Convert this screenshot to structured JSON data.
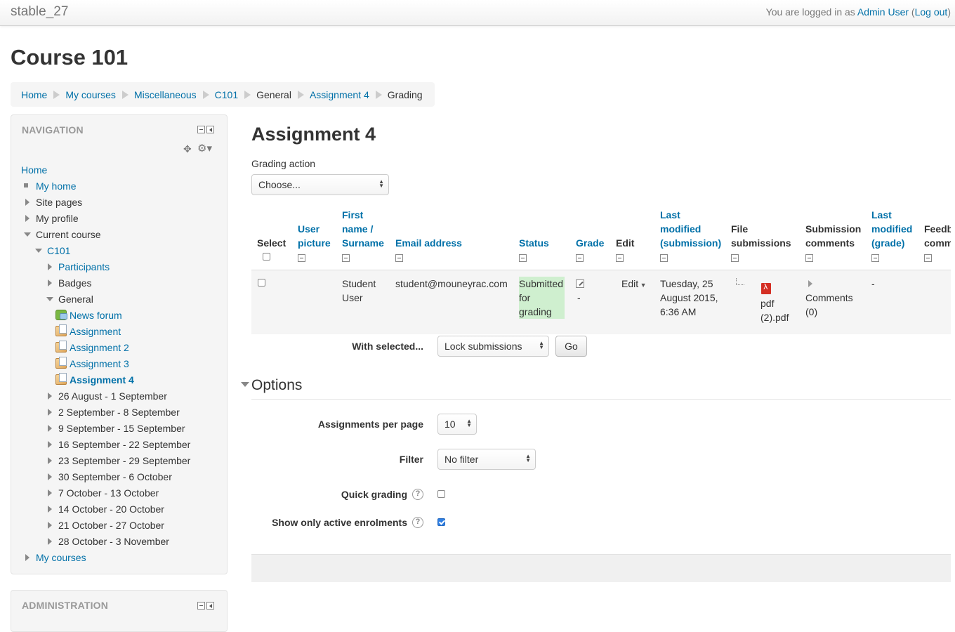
{
  "header": {
    "site_name": "stable_27",
    "logged_in_prefix": "You are logged in as ",
    "user_name": "Admin User",
    "logout_open": " (",
    "logout_label": "Log out",
    "logout_close": ")"
  },
  "course_title": "Course 101",
  "breadcrumb": [
    "Home",
    "My courses",
    "Miscellaneous",
    "C101",
    "General",
    "Assignment 4",
    "Grading"
  ],
  "navigation": {
    "title": "NAVIGATION",
    "items": [
      {
        "label": "Home"
      },
      {
        "label": "My home"
      },
      {
        "label": "Site pages"
      },
      {
        "label": "My profile"
      },
      {
        "label": "Current course"
      },
      {
        "label": "C101"
      },
      {
        "label": "Participants"
      },
      {
        "label": "Badges"
      },
      {
        "label": "General"
      },
      {
        "label": "News forum"
      },
      {
        "label": "Assignment"
      },
      {
        "label": "Assignment 2"
      },
      {
        "label": "Assignment 3"
      },
      {
        "label": "Assignment 4"
      },
      {
        "label": "26 August - 1 September"
      },
      {
        "label": "2 September - 8 September"
      },
      {
        "label": "9 September - 15 September"
      },
      {
        "label": "16 September - 22 September"
      },
      {
        "label": "23 September - 29 September"
      },
      {
        "label": "30 September - 6 October"
      },
      {
        "label": "7 October - 13 October"
      },
      {
        "label": "14 October - 20 October"
      },
      {
        "label": "21 October - 27 October"
      },
      {
        "label": "28 October - 3 November"
      },
      {
        "label": "My courses"
      }
    ]
  },
  "administration": {
    "title": "ADMINISTRATION"
  },
  "main": {
    "title": "Assignment 4",
    "grading_action_label": "Grading action",
    "grading_action_value": "Choose...",
    "table": {
      "headers": {
        "select": "Select",
        "user_picture": [
          "User",
          "picture"
        ],
        "name": [
          "First",
          "name /",
          "Surname"
        ],
        "email": "Email address",
        "status": "Status",
        "grade": "Grade",
        "edit": "Edit",
        "last_modified_submission": [
          "Last",
          "modified",
          "(submission)"
        ],
        "file_submissions": [
          "File",
          "submissions"
        ],
        "submission_comments": [
          "Submission",
          "comments"
        ],
        "last_modified_grade": [
          "Last",
          "modified",
          "(grade)"
        ],
        "feedback": [
          "Feedb",
          "comm"
        ]
      },
      "row": {
        "name": [
          "Student",
          "User"
        ],
        "email": "student@mouneyrac.com",
        "status": [
          "Submitted",
          "for",
          "grading"
        ],
        "grade": "-",
        "edit": "Edit",
        "last_modified": [
          "Tuesday, 25",
          "August 2015,",
          "6:36 AM"
        ],
        "file": [
          "pdf",
          "(2).pdf"
        ],
        "comments": [
          "Comments",
          "(0)"
        ],
        "last_modified_grade": "-"
      }
    },
    "with_selected_label": "With selected...",
    "with_selected_value": "Lock submissions",
    "go_button": "Go",
    "options": {
      "title": "Options",
      "per_page_label": "Assignments per page",
      "per_page_value": "10",
      "filter_label": "Filter",
      "filter_value": "No filter",
      "quick_grading_label": "Quick grading",
      "quick_grading_checked": false,
      "active_enrolments_label": "Show only active enrolments",
      "active_enrolments_checked": true
    }
  },
  "colors": {
    "link": "#0070a8",
    "status_submitted": "#cfefcf",
    "block_bg": "#f5f5f5"
  }
}
